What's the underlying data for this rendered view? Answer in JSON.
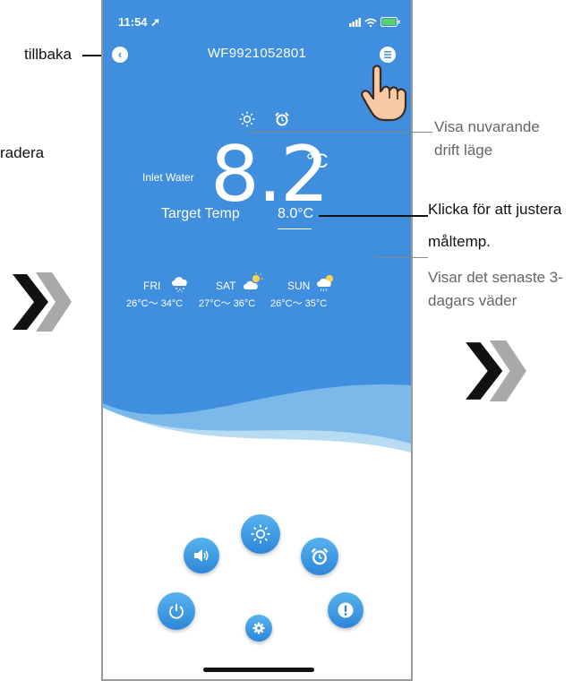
{
  "annotations": {
    "back": "tillbaka",
    "delete": "radera",
    "mode_line1": "Visa nuvarande",
    "mode_line2": "drift läge",
    "adjust_line1": "Klicka för att justera",
    "adjust_line2": "måltemp.",
    "weather_line1": "Visar det senaste 3-",
    "weather_line2": "dagars väder"
  },
  "status_bar": {
    "time": "11:54"
  },
  "header": {
    "title": "WF9921052801",
    "back_icon": "chevron-left-icon",
    "menu_icon": "menu-icon"
  },
  "main": {
    "mode_icons": [
      "sun-icon",
      "alarm-clock-icon"
    ],
    "inlet_label": "Inlet Water",
    "inlet_value": "8.2",
    "inlet_unit": "°C",
    "target_label": "Target Temp",
    "target_value": "8.0°C"
  },
  "weather": [
    {
      "day": "FRI",
      "range": "26°C～ 34°C",
      "icon": "rain-cloud-icon"
    },
    {
      "day": "SAT",
      "range": "27°C～ 36°C",
      "icon": "partly-sunny-icon"
    },
    {
      "day": "SUN",
      "range": "26°C～ 35°C",
      "icon": "sun-rain-icon"
    }
  ],
  "controls": [
    "sound-icon",
    "sun-mode-icon",
    "alarm-clock-icon",
    "power-icon",
    "settings-gear-icon",
    "alert-icon"
  ],
  "colors": {
    "primary_blue": "#3f8fde",
    "button_gradient_top": "#56b3ee",
    "button_gradient_bottom": "#2e86d8"
  }
}
